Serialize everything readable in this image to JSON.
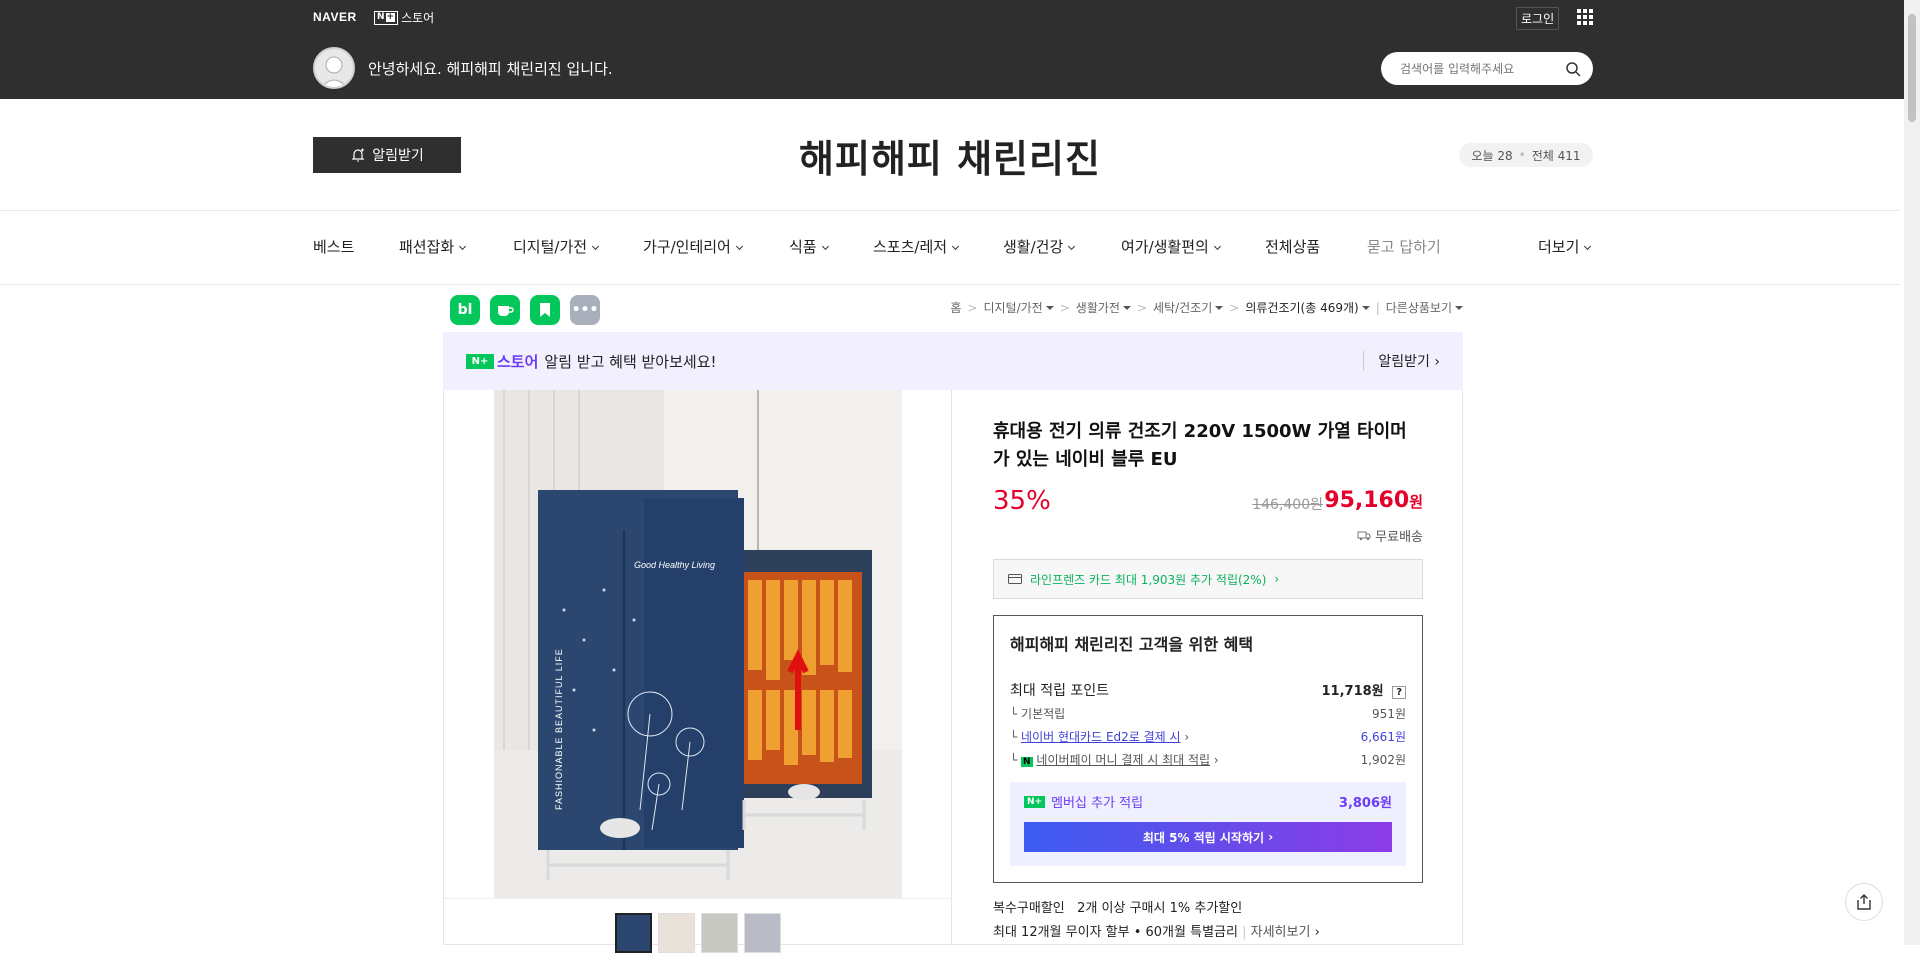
{
  "topbar": {
    "naver": "NAVER",
    "nplus_store": "스토어",
    "login": "로그인",
    "greeting": "안녕하세요. 해피해피 채린리진 입니다.",
    "search_placeholder": "검색어를 입력해주세요"
  },
  "header": {
    "alarm_button": "알림받기",
    "store_name": "해피해피 채린리진",
    "visits_today": "오늘 28",
    "visits_total": "전체 411"
  },
  "gnb": [
    "베스트",
    "패션잡화",
    "디지털/가전",
    "가구/인테리어",
    "식품",
    "스포츠/레저",
    "생활/건강",
    "여가/생활편의",
    "전체상품",
    "묻고 답하기",
    "더보기"
  ],
  "breadcrumb": {
    "home": "홈",
    "cat1": "디지털/가전",
    "cat2": "생활가전",
    "cat3": "세탁/건조기",
    "current": "의류건조기",
    "count": "(총 469개)",
    "other": "다른상품보기"
  },
  "promo": {
    "store": "스토어",
    "text": "알림 받고 혜택 받아보세요!",
    "alarm": "알림받기"
  },
  "product": {
    "title": "휴대용 전기 의류 건조기 220V 1500W 가열 타이머가 있는 네이비 블루 EU",
    "discount": "35%",
    "original_price": "146,400원",
    "sale_price": "95,160",
    "sale_unit": "원",
    "shipping": "무료배송",
    "card_offer": "라인프렌즈 카드 최대 1,903원 추가 적립(2%)",
    "image_text1": "Good Healthy Living",
    "image_text2": "FASHIONABLE BEAUTIFUL LIFE"
  },
  "benefit": {
    "title": "해피해피 채린리진 고객을 위한 혜택",
    "max_label": "최대 적립 포인트",
    "max_value": "11,718원",
    "basic_label": "기본적립",
    "basic_value": "951원",
    "card_label": "네이버 현대카드 Ed2로 결제 시",
    "card_value": "6,661원",
    "pay_label": "네이버페이 머니 결제 시 최대 적립",
    "pay_value": "1,902원",
    "member_label": "멤버십 추가 적립",
    "member_value": "3,806원",
    "member_button": "최대 5% 적립 시작하기"
  },
  "extra": {
    "multi_label": "복수구매할인",
    "multi_text": "2개 이상 구매시 1% 추가할인",
    "installment": "최대 12개월 무이자 할부 • 60개월 특별금리",
    "more": "자세히보기"
  },
  "colors": {
    "accent": "#e4002b",
    "green": "#03c75a",
    "purple": "#6d3cf6"
  }
}
